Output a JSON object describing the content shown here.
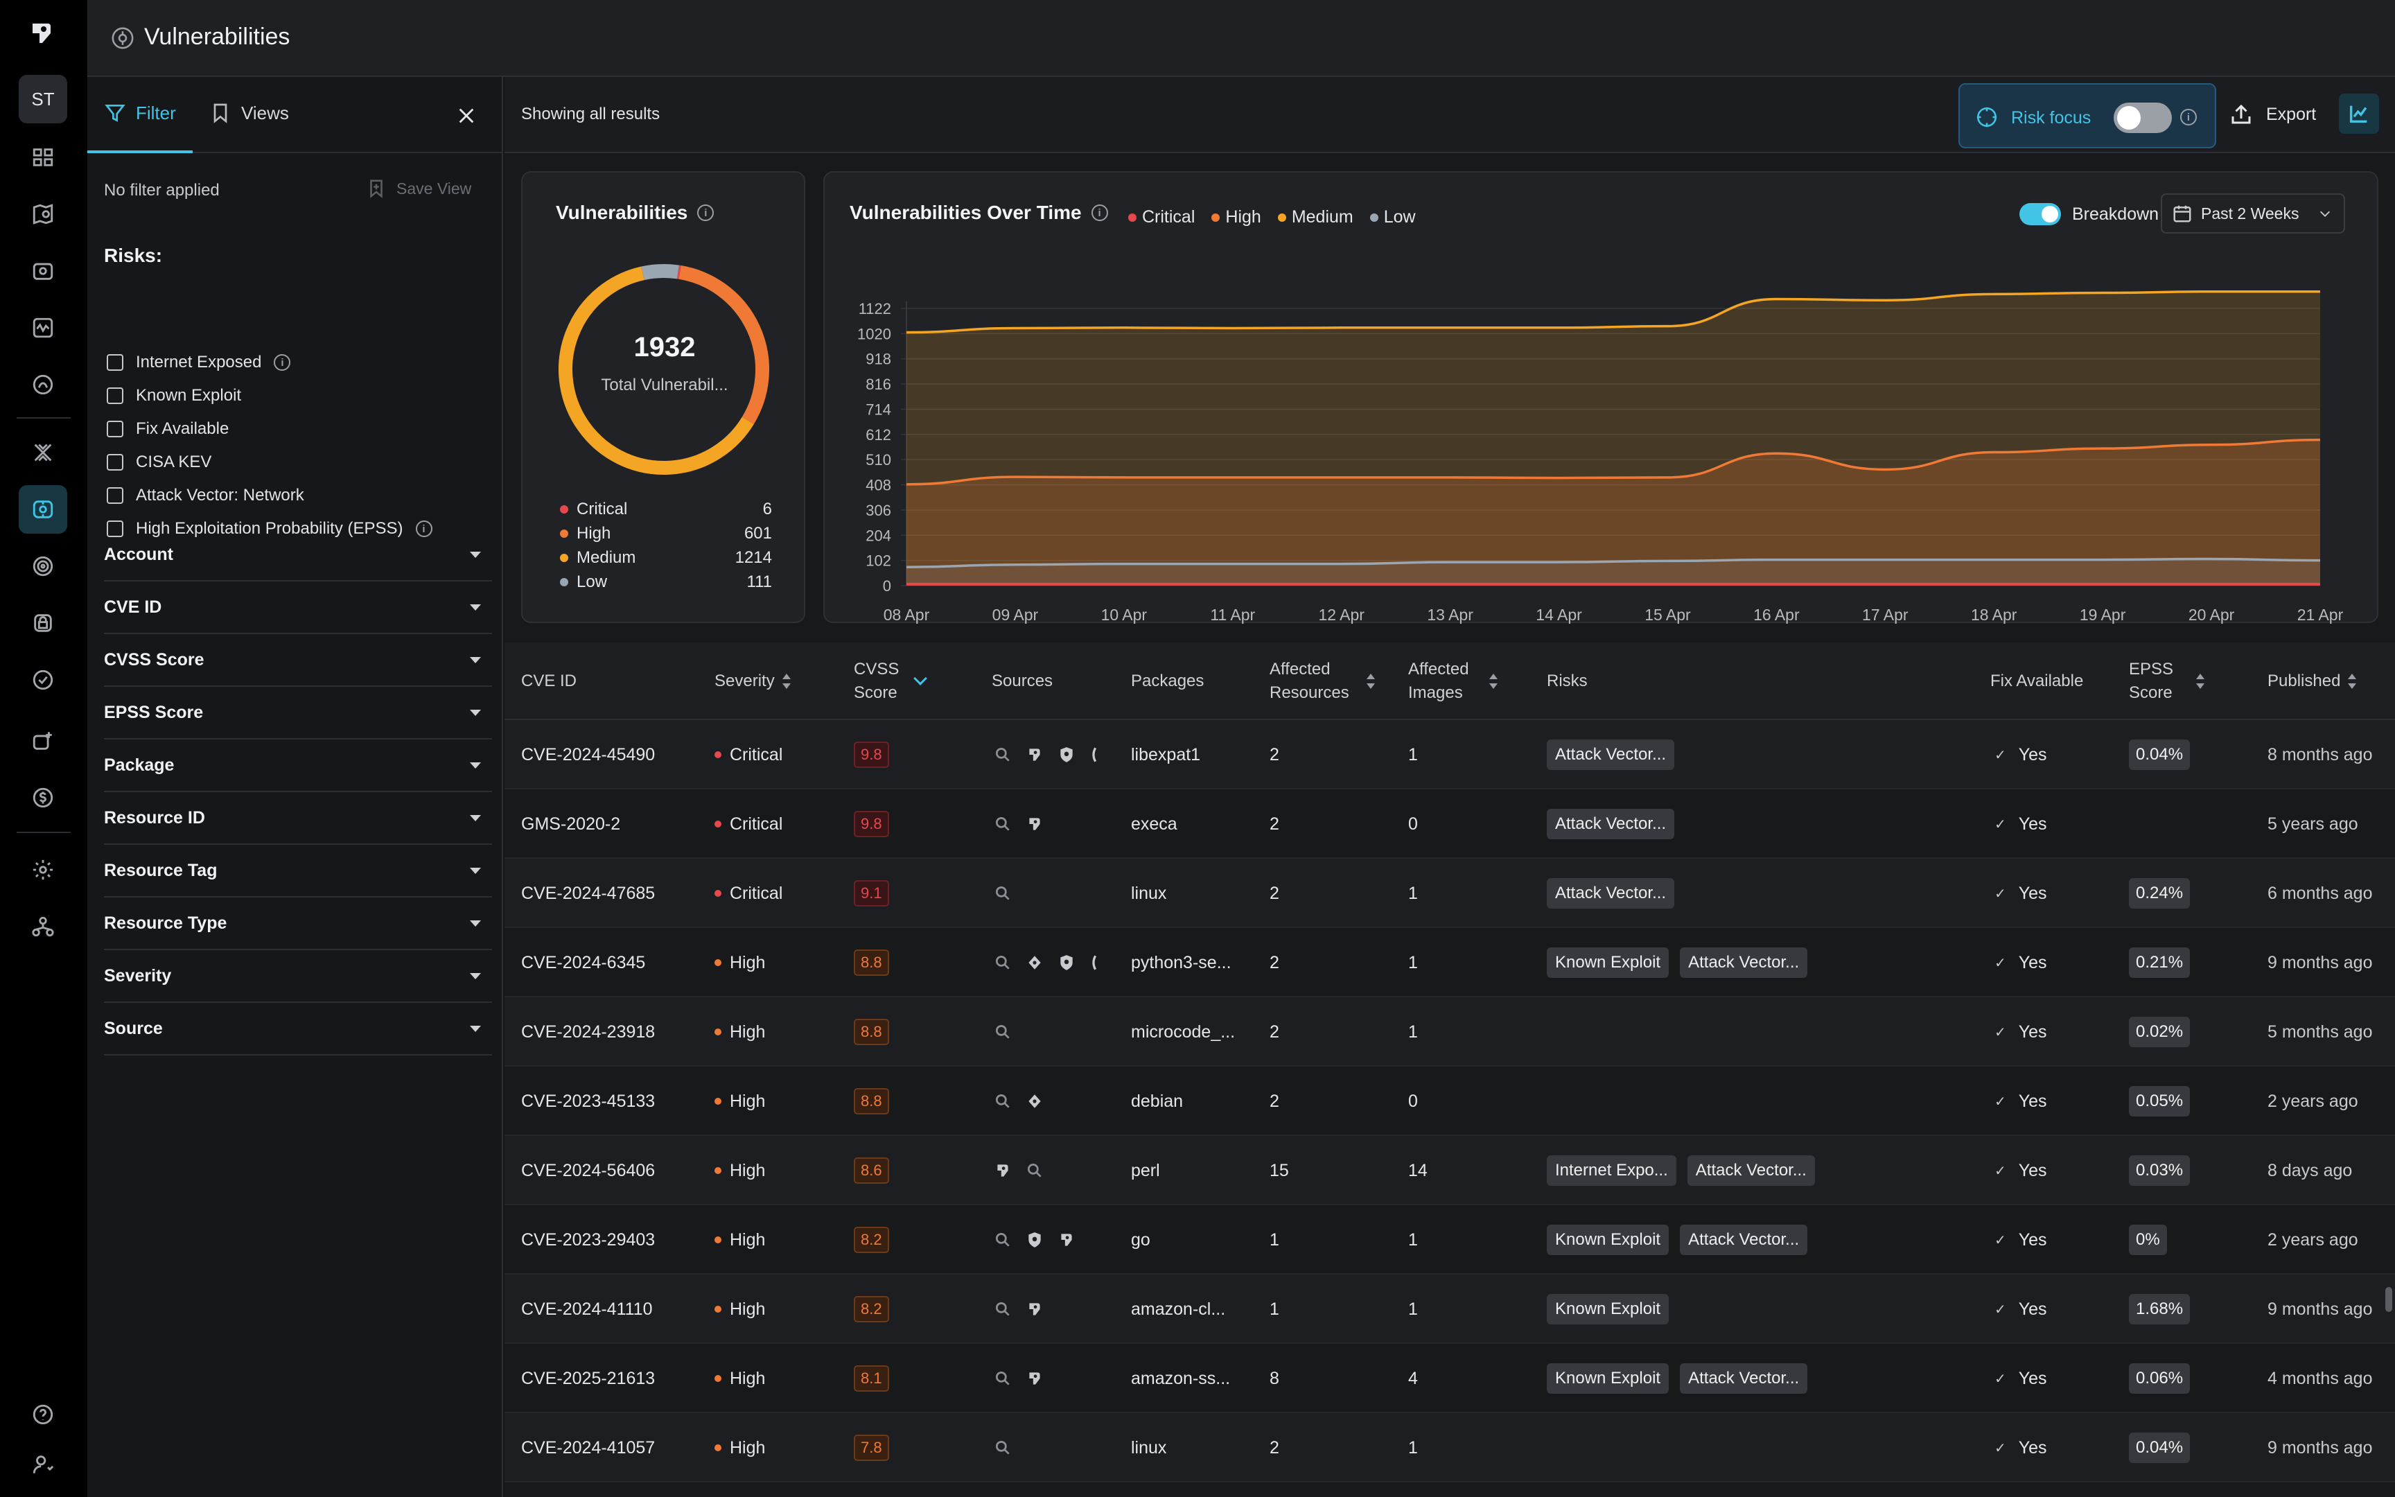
{
  "rail": {
    "avatar": "ST"
  },
  "page": {
    "title": "Vulnerabilities"
  },
  "sidebar": {
    "tabs": {
      "filter": "Filter",
      "views": "Views"
    },
    "no_filter": "No filter applied",
    "save_view": "Save View",
    "risks_heading": "Risks:",
    "risks": [
      "Internet Exposed",
      "Known Exploit",
      "Fix Available",
      "CISA KEV",
      "Attack Vector: Network",
      "High Exploitation Probability (EPSS)"
    ],
    "filters": [
      "Account",
      "CVE ID",
      "CVSS Score",
      "EPSS Score",
      "Package",
      "Resource ID",
      "Resource Tag",
      "Resource Type",
      "Severity",
      "Source"
    ]
  },
  "toolbar": {
    "showing": "Showing all results",
    "risk_focus": "Risk focus",
    "export": "Export"
  },
  "summary": {
    "title": "Vulnerabilities",
    "total": "1932",
    "total_label": "Total Vulnerabil...",
    "breakdown": [
      {
        "label": "Critical",
        "value": "6",
        "color": "#e5484d"
      },
      {
        "label": "High",
        "value": "601",
        "color": "#f07a35"
      },
      {
        "label": "Medium",
        "value": "1214",
        "color": "#f5a524"
      },
      {
        "label": "Low",
        "value": "111",
        "color": "#9aa6b2"
      }
    ]
  },
  "over_time": {
    "title": "Vulnerabilities Over Time",
    "legend": [
      "Critical",
      "High",
      "Medium",
      "Low"
    ],
    "breakdown_label": "Breakdown",
    "period": "Past 2 Weeks"
  },
  "chart_data": {
    "type": "area",
    "title": "Vulnerabilities Over Time",
    "x": [
      "08 Apr",
      "09 Apr",
      "10 Apr",
      "11 Apr",
      "12 Apr",
      "13 Apr",
      "14 Apr",
      "15 Apr",
      "16 Apr",
      "17 Apr",
      "18 Apr",
      "19 Apr",
      "20 Apr",
      "21 Apr"
    ],
    "yticks": [
      0,
      102,
      204,
      306,
      408,
      510,
      612,
      714,
      816,
      918,
      1020,
      1122
    ],
    "ylim": [
      0,
      1122
    ],
    "stacked": false,
    "grid": true,
    "legend_position": "top",
    "series": [
      {
        "name": "Critical",
        "color": "#e5484d",
        "values": [
          6,
          6,
          6,
          6,
          6,
          6,
          6,
          6,
          6,
          6,
          6,
          6,
          6,
          6
        ]
      },
      {
        "name": "High",
        "color": "#f07a35",
        "values": [
          410,
          440,
          438,
          438,
          438,
          438,
          436,
          438,
          535,
          470,
          540,
          555,
          570,
          590
        ]
      },
      {
        "name": "Medium",
        "color": "#f5a524",
        "values": [
          1025,
          1042,
          1044,
          1042,
          1044,
          1044,
          1044,
          1050,
          1160,
          1155,
          1180,
          1185,
          1190,
          1190
        ]
      },
      {
        "name": "Low",
        "color": "#9aa6b2",
        "values": [
          75,
          85,
          88,
          88,
          88,
          95,
          95,
          100,
          105,
          105,
          105,
          105,
          108,
          102
        ]
      }
    ]
  },
  "table": {
    "headers": {
      "cve_id": "CVE ID",
      "severity": "Severity",
      "cvss": "CVSS\nScore",
      "sources": "Sources",
      "packages": "Packages",
      "affected_resources": "Affected\nResources",
      "affected_images": "Affected\nImages",
      "risks": "Risks",
      "fix": "Fix Available",
      "epss": "EPSS\nScore",
      "published": "Published"
    },
    "rows": [
      {
        "cve": "CVE-2024-45490",
        "severity": "Critical",
        "cvss": "9.8",
        "sources": 4,
        "package": "libexpat1",
        "res": "2",
        "img": "1",
        "risks": [
          "Attack Vector..."
        ],
        "fix": "Yes",
        "epss": "0.04%",
        "published": "8 months ago"
      },
      {
        "cve": "GMS-2020-2",
        "severity": "Critical",
        "cvss": "9.8",
        "sources": 2,
        "package": "execa",
        "res": "2",
        "img": "0",
        "risks": [
          "Attack Vector..."
        ],
        "fix": "Yes",
        "epss": "",
        "published": "5 years ago"
      },
      {
        "cve": "CVE-2024-47685",
        "severity": "Critical",
        "cvss": "9.1",
        "sources": 1,
        "package": "linux",
        "res": "2",
        "img": "1",
        "risks": [
          "Attack Vector..."
        ],
        "fix": "Yes",
        "epss": "0.24%",
        "published": "6 months ago"
      },
      {
        "cve": "CVE-2024-6345",
        "severity": "High",
        "cvss": "8.8",
        "sources": 4,
        "package": "python3-se...",
        "res": "2",
        "img": "1",
        "risks": [
          "Known Exploit",
          "Attack Vector..."
        ],
        "fix": "Yes",
        "epss": "0.21%",
        "published": "9 months ago"
      },
      {
        "cve": "CVE-2024-23918",
        "severity": "High",
        "cvss": "8.8",
        "sources": 1,
        "package": "microcode_...",
        "res": "2",
        "img": "1",
        "risks": [],
        "fix": "Yes",
        "epss": "0.02%",
        "published": "5 months ago"
      },
      {
        "cve": "CVE-2023-45133",
        "severity": "High",
        "cvss": "8.8",
        "sources": 2,
        "package": "debian",
        "res": "2",
        "img": "0",
        "risks": [],
        "fix": "Yes",
        "epss": "0.05%",
        "published": "2 years ago"
      },
      {
        "cve": "CVE-2024-56406",
        "severity": "High",
        "cvss": "8.6",
        "sources": 2,
        "package": "perl",
        "res": "15",
        "img": "14",
        "risks": [
          "Internet Expo...",
          "Attack Vector..."
        ],
        "fix": "Yes",
        "epss": "0.03%",
        "published": "8 days ago"
      },
      {
        "cve": "CVE-2023-29403",
        "severity": "High",
        "cvss": "8.2",
        "sources": 3,
        "package": "go",
        "res": "1",
        "img": "1",
        "risks": [
          "Known Exploit",
          "Attack Vector..."
        ],
        "fix": "Yes",
        "epss": "0%",
        "published": "2 years ago"
      },
      {
        "cve": "CVE-2024-41110",
        "severity": "High",
        "cvss": "8.2",
        "sources": 2,
        "package": "amazon-cl...",
        "res": "1",
        "img": "1",
        "risks": [
          "Known Exploit"
        ],
        "fix": "Yes",
        "epss": "1.68%",
        "published": "9 months ago"
      },
      {
        "cve": "CVE-2025-21613",
        "severity": "High",
        "cvss": "8.1",
        "sources": 2,
        "package": "amazon-ss...",
        "res": "8",
        "img": "4",
        "risks": [
          "Known Exploit",
          "Attack Vector..."
        ],
        "fix": "Yes",
        "epss": "0.06%",
        "published": "4 months ago"
      },
      {
        "cve": "CVE-2024-41057",
        "severity": "High",
        "cvss": "7.8",
        "sources": 1,
        "package": "linux",
        "res": "2",
        "img": "1",
        "risks": [],
        "fix": "Yes",
        "epss": "0.04%",
        "published": "9 months ago"
      }
    ]
  }
}
